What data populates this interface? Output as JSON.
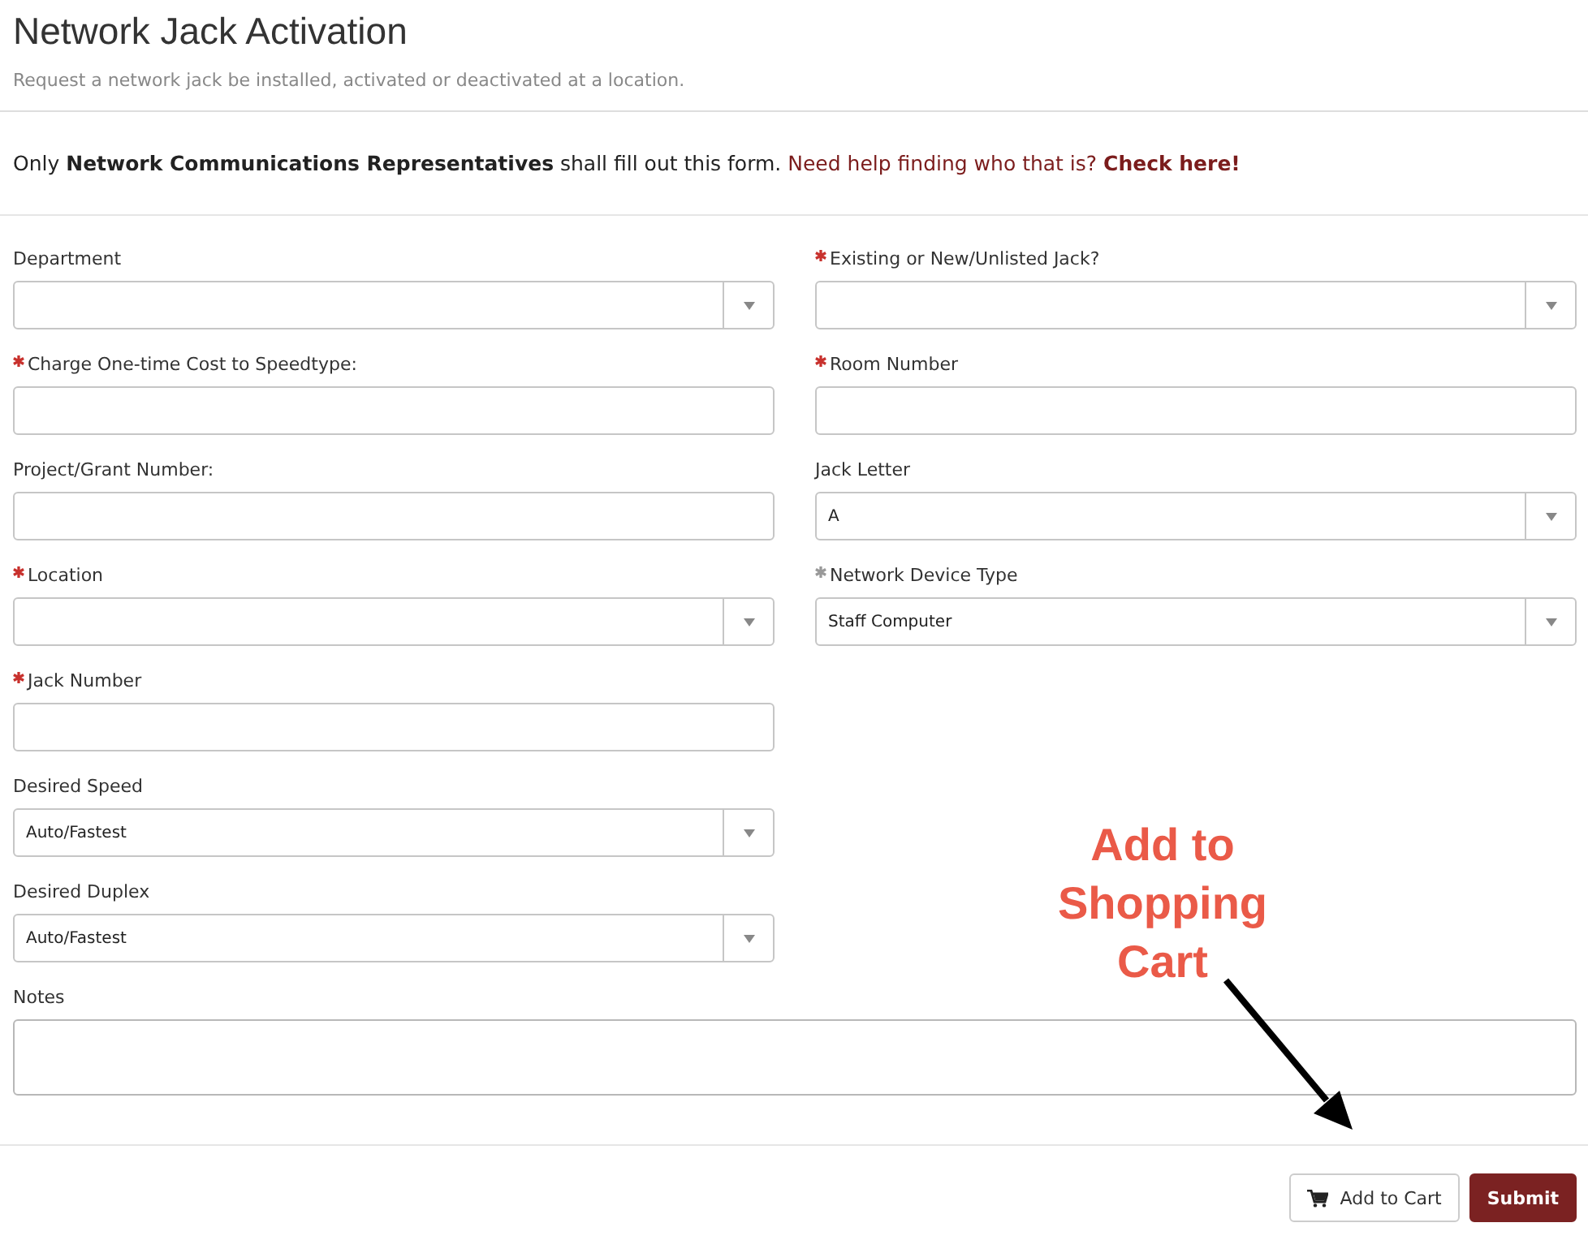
{
  "header": {
    "title": "Network Jack Activation",
    "subtitle": "Request a network jack be installed, activated or deactivated at a location."
  },
  "notice": {
    "text": "Only **Network Communications Representatives** shall fill out this form.",
    "link": "Need help finding who that is? **Check here!**"
  },
  "left_fields": [
    {
      "label": "Department",
      "kind": "select",
      "required": false
    },
    {
      "label": "Charge One-time Cost to Speedtype:",
      "kind": "text",
      "required": true,
      "satisfied": false
    },
    {
      "label": "Project/Grant Number:",
      "kind": "text",
      "required": false
    },
    {
      "label": "Location",
      "kind": "select",
      "required": true,
      "satisfied": false
    },
    {
      "label": "Jack Number",
      "kind": "text",
      "required": true,
      "satisfied": false
    },
    {
      "label": "Desired Speed",
      "kind": "select",
      "required": false,
      "value": "Auto/Fastest"
    },
    {
      "label": "Desired Duplex",
      "kind": "select",
      "required": false,
      "value": "Auto/Fastest"
    }
  ],
  "right_fields": [
    {
      "label": "Existing or New/Unlisted Jack?",
      "kind": "select",
      "required": true,
      "satisfied": false
    },
    {
      "label": "Room Number",
      "kind": "text",
      "required": true,
      "satisfied": false
    },
    {
      "label": "Jack Letter",
      "kind": "select",
      "required": false,
      "value": "A"
    },
    {
      "label": "Network Device Type",
      "kind": "select",
      "required": true,
      "satisfied": true,
      "value": "Staff Computer"
    }
  ],
  "notes": {
    "label": "Notes",
    "kind": "textarea"
  },
  "buttons": [
    {
      "label": "Add to Cart",
      "kind": "cart"
    },
    {
      "label": "Submit",
      "kind": "primary"
    }
  ],
  "annotation": {
    "text": "Add to Shopping Cart"
  }
}
